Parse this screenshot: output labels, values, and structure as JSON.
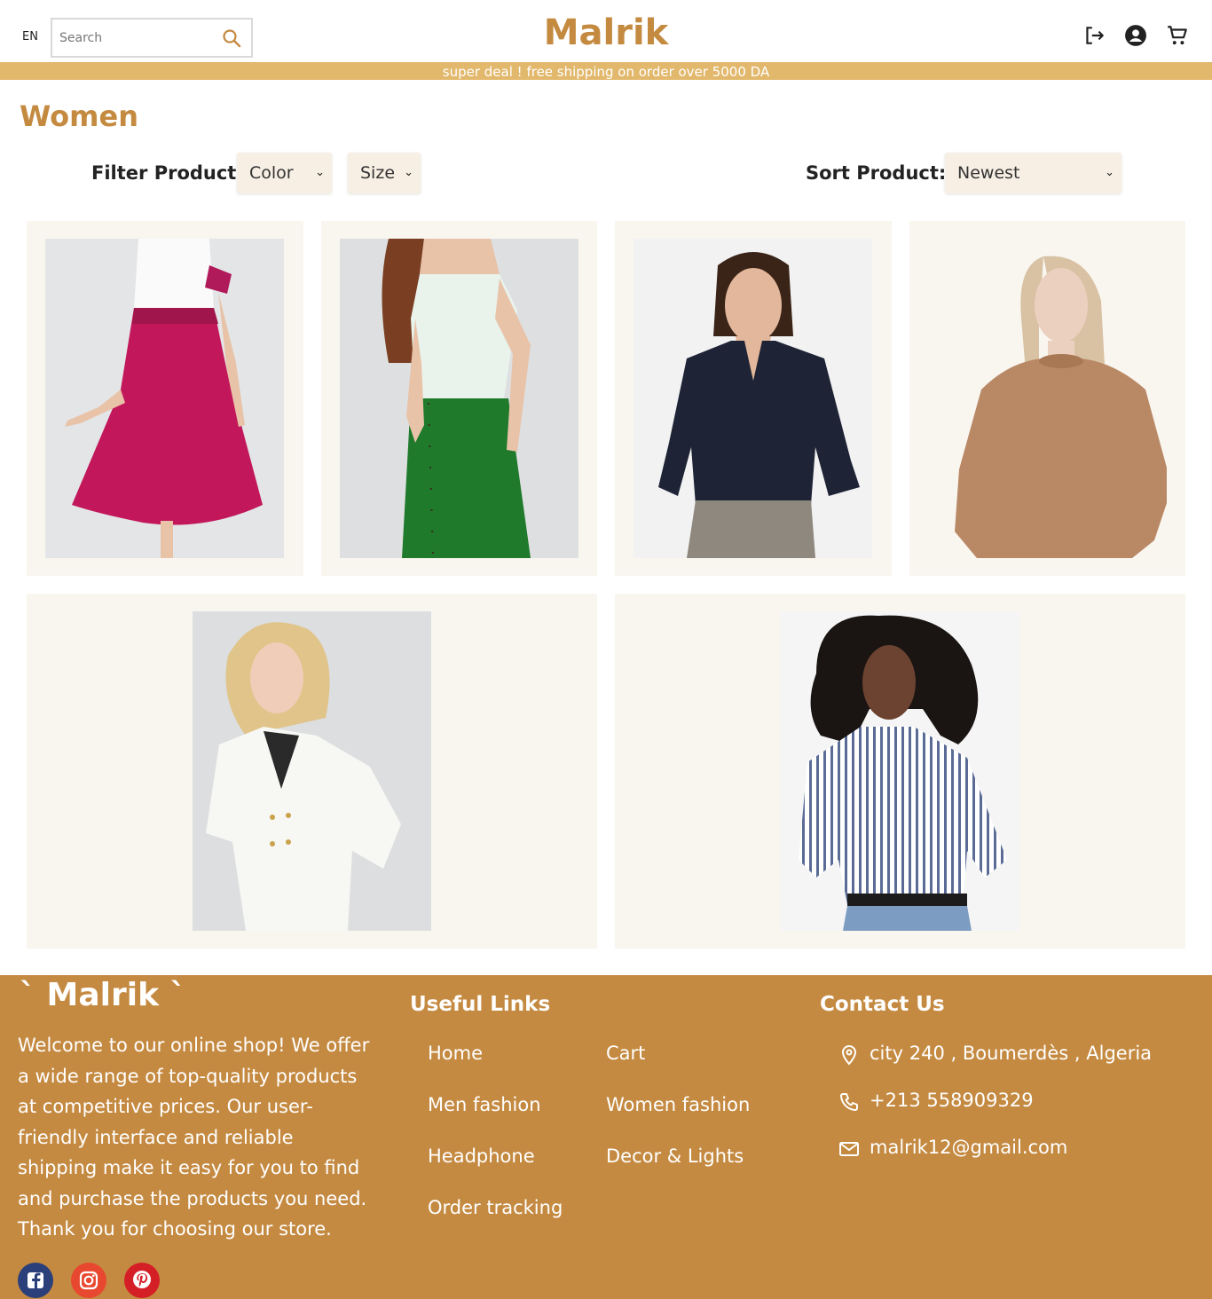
{
  "header": {
    "lang": "EN",
    "search_placeholder": "Search",
    "logo": "Malrik",
    "icons": [
      "logout-icon",
      "account-icon",
      "cart-icon"
    ]
  },
  "promo": "super deal ! free shipping on order over 5000 DA",
  "page": {
    "title": "Women",
    "filter_label": "Filter Product:",
    "filter_color": "Color",
    "filter_size": "Size",
    "sort_label": "Sort Product:",
    "sort_value": "Newest"
  },
  "colors": {
    "brand": "#c48a40",
    "promo_bar": "#e2b86c",
    "footer": "#c58a41",
    "card_bg": "#f9f6f0",
    "select_bg": "#f7efe4"
  },
  "products": [
    {
      "image": "woman in magenta flared skirt and white top"
    },
    {
      "image": "woman in green button skirt and white tee"
    },
    {
      "image": "woman in navy blouse"
    },
    {
      "image": "woman in camel sweater"
    },
    {
      "image": "blonde woman in white blazer"
    },
    {
      "image": "woman in striped shirt"
    }
  ],
  "footer": {
    "logo": "` Malrik `",
    "about": "Welcome to our online shop! We offer a wide range of top-quality products at competitive prices. Our user-friendly interface and reliable shipping make it easy for you to find and purchase the products you need. Thank you for choosing our store.",
    "links_heading": "Useful Links",
    "links": {
      "home": "Home",
      "cart": "Cart",
      "men": "Men fashion",
      "women": "Women fashion",
      "headphone": "Headphone",
      "decor": "Decor & Lights",
      "tracking": "Order tracking"
    },
    "contact_heading": "Contact Us",
    "address": "city 240 , Boumerdès , Algeria",
    "phone": "+213 558909329",
    "email": "malrik12@gmail.com",
    "social": [
      "facebook-icon",
      "instagram-icon",
      "pinterest-icon"
    ]
  }
}
